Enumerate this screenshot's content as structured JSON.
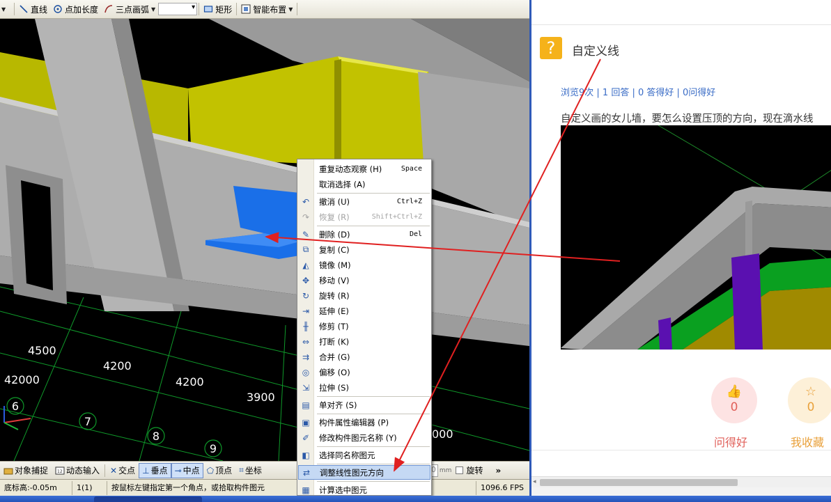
{
  "toolbar": {
    "items": [
      "直线",
      "点加长度",
      "三点画弧",
      "矩形",
      "智能布置"
    ]
  },
  "scene": {
    "axis_numbers": [
      "6",
      "7",
      "8",
      "9"
    ],
    "dims": [
      "4500",
      "4200",
      "42000",
      "4200",
      "3900",
      "000"
    ]
  },
  "context_menu": {
    "items": [
      {
        "label": "重复动态观察 (H)",
        "shortcut": "Space",
        "icon": ""
      },
      {
        "label": "取消选择 (A)",
        "shortcut": "",
        "icon": ""
      },
      {
        "label": "撤消 (U)",
        "shortcut": "Ctrl+Z",
        "icon": "undo-icon"
      },
      {
        "label": "恢复 (R)",
        "shortcut": "Shift+Ctrl+Z",
        "icon": "redo-icon"
      },
      {
        "label": "删除 (D)",
        "shortcut": "Del",
        "icon": "delete-icon"
      },
      {
        "label": "复制 (C)",
        "shortcut": "",
        "icon": "copy-icon"
      },
      {
        "label": "镜像 (M)",
        "shortcut": "",
        "icon": "mirror-icon"
      },
      {
        "label": "移动 (V)",
        "shortcut": "",
        "icon": "move-icon"
      },
      {
        "label": "旋转 (R)",
        "shortcut": "",
        "icon": "rotate-icon"
      },
      {
        "label": "延伸 (E)",
        "shortcut": "",
        "icon": "extend-icon"
      },
      {
        "label": "修剪 (T)",
        "shortcut": "",
        "icon": "trim-icon"
      },
      {
        "label": "打断 (K)",
        "shortcut": "",
        "icon": "break-icon"
      },
      {
        "label": "合并 (G)",
        "shortcut": "",
        "icon": "merge-icon"
      },
      {
        "label": "偏移 (O)",
        "shortcut": "",
        "icon": "offset-icon"
      },
      {
        "label": "拉伸 (S)",
        "shortcut": "",
        "icon": "stretch-icon"
      },
      {
        "label": "单对齐 (S)",
        "shortcut": "",
        "icon": "align-icon"
      },
      {
        "label": "构件属性编辑器 (P)",
        "shortcut": "",
        "icon": "property-editor-icon"
      },
      {
        "label": "修改构件图元名称 (Y)",
        "shortcut": "",
        "icon": "rename-icon"
      },
      {
        "label": "选择同名称图元",
        "shortcut": "",
        "icon": "select-same-icon"
      },
      {
        "label": "调整线性图元方向",
        "shortcut": "",
        "icon": "adjust-direction-icon"
      },
      {
        "label": "计算选中图元",
        "shortcut": "",
        "icon": "calculate-icon"
      }
    ]
  },
  "snapbar": {
    "items": [
      "对象捕捉",
      "动态输入",
      "交点",
      "垂点",
      "中点",
      "顶点",
      "坐标"
    ],
    "spin_value": "0",
    "unit": "mm",
    "rotate_label": "旋转"
  },
  "statusbar": {
    "floor_height": "底标高:-0.05m",
    "layer": "1(1)",
    "hint": "按鼠标左键指定第一个角点，或拾取构件图元",
    "fps": "1096.6 FPS"
  },
  "question": {
    "title": "自定义线",
    "stats": "浏览9次 | 1 回答 | 0 答得好 | 0问得好",
    "body": "自定义画的女儿墙，要怎么设置压顶的方向，现在滴水线",
    "good_count": "0",
    "good_label": "问得好",
    "fav_count": "0",
    "fav_label": "我收藏"
  },
  "colors": {
    "annotation_arrow": "#e02020",
    "menu_highlight": "#c5d9f4",
    "wall_yellow": "#b8b800",
    "beam_blue": "#1a6fe8"
  }
}
